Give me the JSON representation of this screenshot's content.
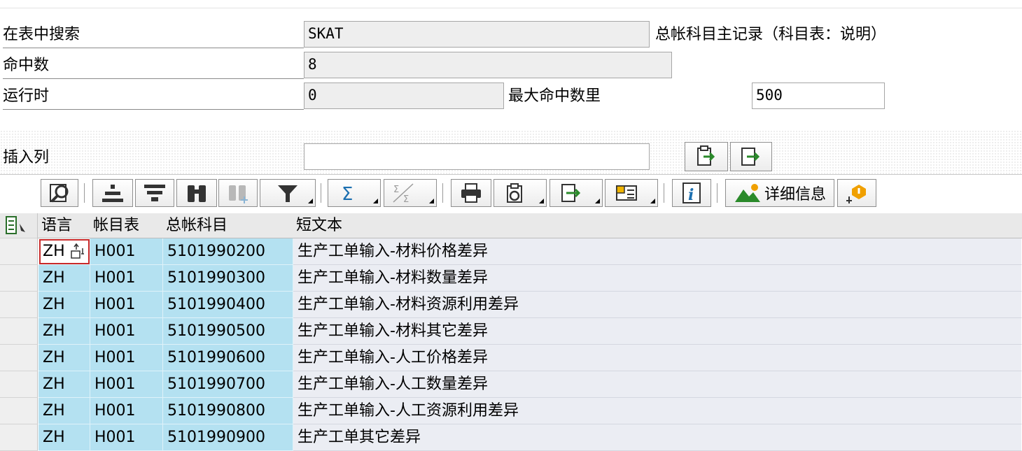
{
  "form": {
    "search_table_label": "在表中搜索",
    "search_table_value": "SKAT",
    "search_table_desc": "总帐科目主记录（科目表：说明）",
    "hits_label": "命中数",
    "hits_value": "8",
    "runtime_label": "运行时",
    "runtime_value": "0",
    "max_hits_label": "最大命中数里",
    "max_hits_value": "500",
    "insert_col_label": "插入列",
    "insert_col_value": ""
  },
  "toolbar": {
    "details_label": "详细信息"
  },
  "table": {
    "headers": [
      "语言",
      "帐目表",
      "总帐科目",
      "短文本"
    ],
    "rows": [
      [
        "ZH",
        "H001",
        "5101990200",
        "生产工单输入-材料价格差异"
      ],
      [
        "ZH",
        "H001",
        "5101990300",
        "生产工单输入-材料数量差异"
      ],
      [
        "ZH",
        "H001",
        "5101990400",
        "生产工单输入-材料资源利用差异"
      ],
      [
        "ZH",
        "H001",
        "5101990500",
        "生产工单输入-材料其它差异"
      ],
      [
        "ZH",
        "H001",
        "5101990600",
        "生产工单输入-人工价格差异"
      ],
      [
        "ZH",
        "H001",
        "5101990700",
        "生产工单输入-人工数量差异"
      ],
      [
        "ZH",
        "H001",
        "5101990800",
        "生产工单输入-人工资源利用差异"
      ],
      [
        "ZH",
        "H001",
        "5101990900",
        "生产工单其它差异"
      ]
    ]
  },
  "colors": {
    "key_cell": "#b4e1f1",
    "text_cell": "#ebedf3",
    "focus_border": "#c92a2a"
  }
}
